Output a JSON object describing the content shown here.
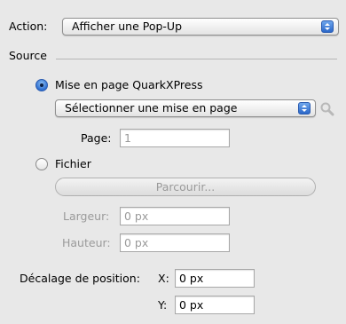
{
  "action": {
    "label": "Action:",
    "value": "Afficher une Pop-Up"
  },
  "source": {
    "title": "Source",
    "option_layout": {
      "label": "Mise en page QuarkXPress",
      "selected": true
    },
    "layout_select": {
      "value": "Sélectionner une mise en page"
    },
    "page": {
      "label": "Page:",
      "value": "1"
    },
    "option_file": {
      "label": "Fichier",
      "selected": false
    },
    "browse_label": "Parcourir...",
    "width": {
      "label": "Largeur:",
      "value": "0 px"
    },
    "height": {
      "label": "Hauteur:",
      "value": "0 px"
    }
  },
  "offset": {
    "label": "Décalage de position:",
    "x_label": "X:",
    "x_value": "0 px",
    "y_label": "Y:",
    "y_value": "0 px"
  },
  "icons": {
    "popup_arrows": "up-down-arrows-icon",
    "search": "magnifier-icon"
  },
  "colors": {
    "accent": "#2f6fd0",
    "background": "#e8e8e8"
  }
}
